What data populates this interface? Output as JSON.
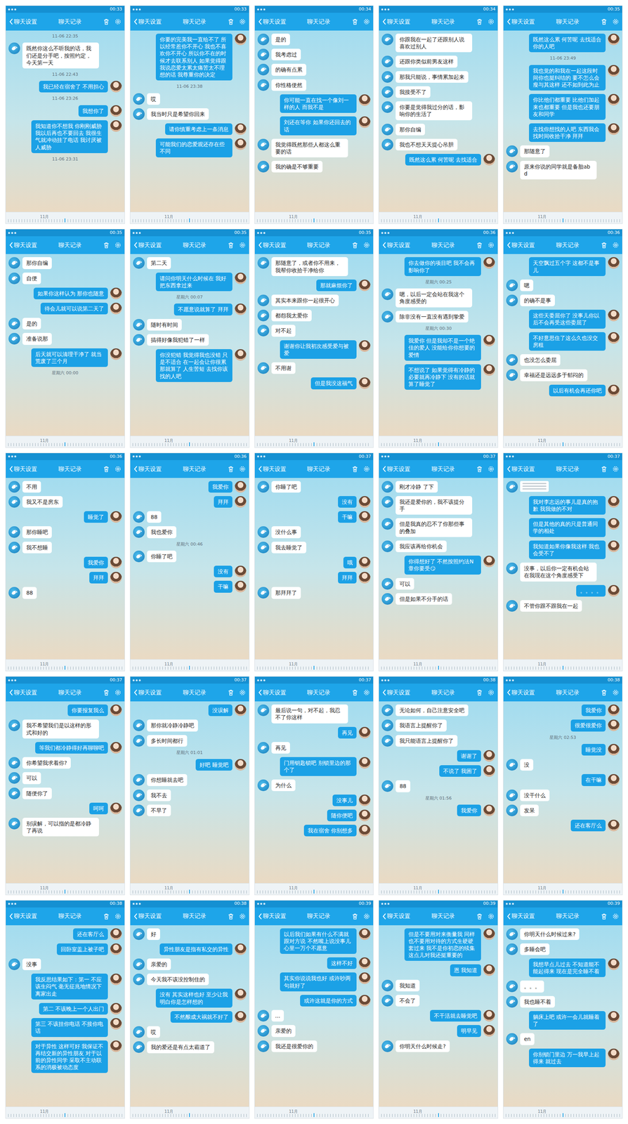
{
  "panels": [
    {
      "status_time": "00:33",
      "header": {
        "back": "聊天设置",
        "title": "聊天记录"
      },
      "timeline": "11月",
      "messages": [
        {
          "kind": "time",
          "text": "11-06 22:35"
        },
        {
          "kind": "in",
          "text": "既然你这么不听我的话，我们还是分手吧，按照约定，今天第一天"
        },
        {
          "kind": "time",
          "text": "11-06 22:43"
        },
        {
          "kind": "out",
          "text": "我已经在宿舍了  不用担心"
        },
        {
          "kind": "time",
          "text": "11-06 23:26"
        },
        {
          "kind": "out",
          "text": "我想你了"
        },
        {
          "kind": "out",
          "text": "我知道你不想我  你刚刚威胁我以后再也不要回去  我很生气就冲动挂了电话  我讨厌被人威胁"
        },
        {
          "kind": "time",
          "text": "11-06 23:31"
        }
      ]
    },
    {
      "status_time": "00:33",
      "header": {
        "back": "聊天设置",
        "title": "聊天记录"
      },
      "timeline": "11月",
      "messages": [
        {
          "kind": "out",
          "text": "你要的完美我一直给不了  所以经常惹你不开心  我也不喜欢你不开心  所以你不在的时候才去联系别人  如果觉得跟我说恋爱太累太痛苦太不理想的话  我尊重你的决定"
        },
        {
          "kind": "time",
          "text": "11-06 23:38"
        },
        {
          "kind": "in",
          "text": "哎"
        },
        {
          "kind": "in",
          "text": "我当时只是希望你回来"
        },
        {
          "kind": "out",
          "text": "请你慎重考虑上一条消息"
        },
        {
          "kind": "out",
          "text": "可能我们的恋爱观还存在些不同"
        }
      ]
    },
    {
      "status_time": "00:34",
      "header": {
        "back": "聊天设置",
        "title": "聊天记录"
      },
      "timeline": "11月",
      "messages": [
        {
          "kind": "in",
          "text": "是的"
        },
        {
          "kind": "in",
          "text": "我考虑过"
        },
        {
          "kind": "in",
          "text": "的确有点累"
        },
        {
          "kind": "in",
          "text": "你性格使然"
        },
        {
          "kind": "out",
          "text": "你可能一直在找一个像刘一样的人  而我不是"
        },
        {
          "kind": "out",
          "text": "刘还在等你  如果你还回去的话"
        },
        {
          "kind": "in",
          "text": "我觉得既然那些人都这么重要的话"
        },
        {
          "kind": "in",
          "text": "我的确是不够重要"
        }
      ]
    },
    {
      "status_time": "00:34",
      "header": {
        "back": "聊天设置",
        "title": "聊天记录"
      },
      "timeline": "11月",
      "messages": [
        {
          "kind": "in",
          "text": "你跟我在一起了还跟别人说喜欢过别人"
        },
        {
          "kind": "in",
          "text": "还跟你类似前男友这样"
        },
        {
          "kind": "in",
          "text": "那我只能说，事情累加起来"
        },
        {
          "kind": "in",
          "text": "我接受不了"
        },
        {
          "kind": "in",
          "text": "你要是觉得我过分的话，影响你的生活了"
        },
        {
          "kind": "in",
          "text": "那你自编"
        },
        {
          "kind": "in",
          "text": "我也不想天天提心吊胆"
        },
        {
          "kind": "out",
          "text": "既然这么累  何苦呢  去找适合"
        }
      ]
    },
    {
      "status_time": "00:35",
      "header": {
        "back": "聊天设置",
        "title": "聊天记录"
      },
      "timeline": "11月",
      "messages": [
        {
          "kind": "out",
          "text": "既然这么累  何苦呢  去找适合你的人吧"
        },
        {
          "kind": "time",
          "text": "11-06 23:49"
        },
        {
          "kind": "out",
          "text": "我也觉的和我在一起这段时间你也挺纠结的  要不怎么会瘦与其这样  还不如到此为止"
        },
        {
          "kind": "out",
          "text": "你比他们都重要  比他们加起来也都重要  但是我也还要朋友和同学"
        },
        {
          "kind": "out",
          "text": "去找你想找的人吧  东西我会找时间收拾干净  拜拜"
        },
        {
          "kind": "in",
          "text": "那随意了"
        },
        {
          "kind": "in",
          "text": "原来你说的同学就是备胎abd"
        }
      ]
    },
    {
      "status_time": "00:35",
      "header": {
        "back": "聊天设置",
        "title": "聊天记录"
      },
      "timeline": "11月",
      "messages": [
        {
          "kind": "in",
          "text": "那你自编"
        },
        {
          "kind": "in",
          "text": "自便"
        },
        {
          "kind": "out",
          "text": "如果你这样认为  那你也随意"
        },
        {
          "kind": "out",
          "text": "待会儿就可以说第二天了"
        },
        {
          "kind": "in",
          "text": "是的"
        },
        {
          "kind": "in",
          "text": "准备说那"
        },
        {
          "kind": "out",
          "text": "后天就可以清理干净了  就当荒废了三个月"
        },
        {
          "kind": "time",
          "text": "星期六 00:00"
        }
      ]
    },
    {
      "status_time": "00:35",
      "header": {
        "back": "聊天设置",
        "title": "聊天记录"
      },
      "timeline": "11月",
      "messages": [
        {
          "kind": "in",
          "text": "第二天"
        },
        {
          "kind": "out",
          "text": "请问你明天什么时候在  我好把东西拿过来"
        },
        {
          "kind": "time",
          "text": "星期六 00:07"
        },
        {
          "kind": "out",
          "text": "不愿意说就算了  拜拜"
        },
        {
          "kind": "in",
          "text": "随时有时间"
        },
        {
          "kind": "in",
          "text": "搞得好像我犯错了一样"
        },
        {
          "kind": "out",
          "text": "你没犯错  我觉得我也没错  只是不适合  在一起会让你很累那就算了  人生苦短  去找你该找的人吧"
        }
      ]
    },
    {
      "status_time": "00:35",
      "header": {
        "back": "聊天设置",
        "title": "聊天记录"
      },
      "timeline": "11月",
      "messages": [
        {
          "kind": "in",
          "text": "那随意了，或者你不用来，我帮你收拾干净给你"
        },
        {
          "kind": "out",
          "text": "那就麻烦你了"
        },
        {
          "kind": "in",
          "text": "其实本来跟你一起很开心"
        },
        {
          "kind": "in",
          "text": "都怨我太爱你"
        },
        {
          "kind": "in",
          "text": "对不起"
        },
        {
          "kind": "out",
          "text": "谢谢你让我初次感受爱与被爱"
        },
        {
          "kind": "in",
          "text": "不用谢"
        },
        {
          "kind": "out",
          "text": "但是我没这福气"
        }
      ]
    },
    {
      "status_time": "00:36",
      "header": {
        "back": "聊天设置",
        "title": "聊天记录"
      },
      "timeline": "11月",
      "messages": [
        {
          "kind": "out",
          "text": "你去做你的项目吧  我不会再影响你了"
        },
        {
          "kind": "time",
          "text": "星期六 00:25"
        },
        {
          "kind": "in",
          "text": "嗯，以后一定会站在我这个角度感受的"
        },
        {
          "kind": "in",
          "text": "除非没有一直没有遇到挚爱"
        },
        {
          "kind": "time",
          "text": "星期六 00:30"
        },
        {
          "kind": "out",
          "text": "我爱你  但是我却不是一个绝佳的爱人  没能给你你想要的爱情"
        },
        {
          "kind": "out",
          "text": "不想说了  如果觉得有冷静的必要就再冷静下  没有的话就算了睡觉了"
        }
      ]
    },
    {
      "status_time": "00:36",
      "header": {
        "back": "聊天设置",
        "title": "聊天记录"
      },
      "timeline": "11月",
      "messages": [
        {
          "kind": "out",
          "text": "天空飘过五个字  这都不是事儿"
        },
        {
          "kind": "in",
          "text": "嗯"
        },
        {
          "kind": "in",
          "text": "的确不是事"
        },
        {
          "kind": "out",
          "text": "这些天委屈你了  没事儿你以后不会再受这些委屈了"
        },
        {
          "kind": "out",
          "text": "不好意思住了这么久也没交房租"
        },
        {
          "kind": "in",
          "text": "也没怎么委屈"
        },
        {
          "kind": "in",
          "text": "幸福还是远远多于郁闷的"
        },
        {
          "kind": "out",
          "text": "以后有机会再还你吧"
        }
      ]
    },
    {
      "status_time": "00:36",
      "header": {
        "back": "聊天设置",
        "title": "聊天记录"
      },
      "timeline": "11月",
      "messages": [
        {
          "kind": "in",
          "text": "不用"
        },
        {
          "kind": "in",
          "text": "我又不是房东"
        },
        {
          "kind": "out",
          "text": "睡觉了"
        },
        {
          "kind": "in",
          "text": "那你睡吧"
        },
        {
          "kind": "in",
          "text": "我不想睡"
        },
        {
          "kind": "out",
          "text": "我爱你"
        },
        {
          "kind": "out",
          "text": "拜拜"
        },
        {
          "kind": "in",
          "text": "88"
        }
      ]
    },
    {
      "status_time": "00:36",
      "header": {
        "back": "聊天设置",
        "title": "聊天记录"
      },
      "timeline": "11月",
      "messages": [
        {
          "kind": "out",
          "text": "我爱你"
        },
        {
          "kind": "out",
          "text": "拜拜"
        },
        {
          "kind": "in",
          "text": "88"
        },
        {
          "kind": "in",
          "text": "我也爱你"
        },
        {
          "kind": "time",
          "text": "星期六 00:46"
        },
        {
          "kind": "in",
          "text": "你睡了吧"
        },
        {
          "kind": "out",
          "text": "没有"
        },
        {
          "kind": "out",
          "text": "干嘛"
        }
      ]
    },
    {
      "status_time": "00:37",
      "header": {
        "back": "聊天设置",
        "title": "聊天记录"
      },
      "timeline": "11月",
      "messages": [
        {
          "kind": "in",
          "text": "你睡了吧"
        },
        {
          "kind": "out",
          "text": "没有"
        },
        {
          "kind": "out",
          "text": "干嘛"
        },
        {
          "kind": "in",
          "text": "没什么事"
        },
        {
          "kind": "in",
          "text": "我去睡觉了"
        },
        {
          "kind": "out",
          "text": "哦"
        },
        {
          "kind": "out",
          "text": "拜拜"
        },
        {
          "kind": "in",
          "text": "那拜拜了"
        }
      ]
    },
    {
      "status_time": "00:37",
      "header": {
        "back": "聊天设置",
        "title": "聊天记录"
      },
      "timeline": "11月",
      "messages": [
        {
          "kind": "in",
          "text": "刚才冷静  了下"
        },
        {
          "kind": "in",
          "text": "我还是爱你的，我不该提分手"
        },
        {
          "kind": "in",
          "text": "但是我真的忍不了你那些事的叠加"
        },
        {
          "kind": "in",
          "text": "我应该再给你机会"
        },
        {
          "kind": "out",
          "text": "你得想好了  不然按照约法N章你要受😏"
        },
        {
          "kind": "in",
          "text": "可以"
        },
        {
          "kind": "in",
          "text": "但是如果不分手的话"
        }
      ]
    },
    {
      "status_time": "00:37",
      "header": {
        "back": "聊天设置",
        "title": "聊天记录"
      },
      "timeline": "11月",
      "messages": [
        {
          "kind": "image"
        },
        {
          "kind": "out",
          "text": "我对李志远的事儿是真的抱歉  我我做的不对"
        },
        {
          "kind": "out",
          "text": "但是其他的真的只是普通同学的相处"
        },
        {
          "kind": "out",
          "text": "我知道如果你像我这样  我也会受不了"
        },
        {
          "kind": "in",
          "text": "没事，以后你一定有机会站在我现在这个角度感受下"
        },
        {
          "kind": "out",
          "text": "。。。。"
        },
        {
          "kind": "in",
          "text": "不管你跟不跟我在一起"
        }
      ]
    },
    {
      "status_time": "00:37",
      "header": {
        "back": "聊天设置",
        "title": "聊天记录"
      },
      "timeline": "11月",
      "messages": [
        {
          "kind": "out",
          "text": "你要报复我么"
        },
        {
          "kind": "in",
          "text": "我不希望我们是以这样的形式和好的"
        },
        {
          "kind": "out",
          "text": "等我们都冷静得好再聊聊吧"
        },
        {
          "kind": "in",
          "text": "你希望我求着你?"
        },
        {
          "kind": "in",
          "text": "可以"
        },
        {
          "kind": "in",
          "text": "随便你了"
        },
        {
          "kind": "out",
          "text": "呵呵"
        },
        {
          "kind": "in",
          "text": "别误解，可以指的是都冷静了再说"
        }
      ]
    },
    {
      "status_time": "00:37",
      "header": {
        "back": "聊天设置",
        "title": "聊天记录"
      },
      "timeline": "11月",
      "messages": [
        {
          "kind": "out",
          "text": "没误解"
        },
        {
          "kind": "in",
          "text": "那你就冷静冷静吧"
        },
        {
          "kind": "in",
          "text": "多长时间都行"
        },
        {
          "kind": "time",
          "text": "星期六 01:01"
        },
        {
          "kind": "out",
          "text": "好吧  睡觉吧"
        },
        {
          "kind": "in",
          "text": "你想睡就去吧"
        },
        {
          "kind": "in",
          "text": "我不去"
        },
        {
          "kind": "in",
          "text": "不早了"
        }
      ]
    },
    {
      "status_time": "00:37",
      "header": {
        "back": "聊天设置",
        "title": "聊天记录"
      },
      "timeline": "11月",
      "messages": [
        {
          "kind": "in",
          "text": "最后说一句，对不起，我忍不了你这样"
        },
        {
          "kind": "out",
          "text": "再见"
        },
        {
          "kind": "in",
          "text": "再见"
        },
        {
          "kind": "out",
          "text": "门用钥匙锁吧  别锁里边的那个了"
        },
        {
          "kind": "in",
          "text": "为什么"
        },
        {
          "kind": "out",
          "text": "没事儿"
        },
        {
          "kind": "out",
          "text": "随你便吧"
        },
        {
          "kind": "out",
          "text": "我在宿舍  你别想多"
        }
      ]
    },
    {
      "status_time": "00:38",
      "header": {
        "back": "聊天设置",
        "title": "聊天记录"
      },
      "timeline": "11月",
      "messages": [
        {
          "kind": "in",
          "text": "无论如何，自己注意安全吧"
        },
        {
          "kind": "in",
          "text": "我语言上提醒你了"
        },
        {
          "kind": "in",
          "text": "我只能语言上提醒你了"
        },
        {
          "kind": "out",
          "text": "谢谢了"
        },
        {
          "kind": "out",
          "text": "不说了  我困了"
        },
        {
          "kind": "in",
          "text": "88"
        },
        {
          "kind": "time",
          "text": "星期六 01:56"
        },
        {
          "kind": "out",
          "text": "我爱你"
        }
      ]
    },
    {
      "status_time": "00:38",
      "header": {
        "back": "聊天设置",
        "title": "聊天记录"
      },
      "timeline": "11月",
      "messages": [
        {
          "kind": "out",
          "text": "我爱你"
        },
        {
          "kind": "out",
          "text": "很爱很爱你"
        },
        {
          "kind": "time",
          "text": "星期六 02:53"
        },
        {
          "kind": "out",
          "text": "睡觉没"
        },
        {
          "kind": "in",
          "text": "没"
        },
        {
          "kind": "out",
          "text": "在干嘛"
        },
        {
          "kind": "in",
          "text": "没干什么"
        },
        {
          "kind": "in",
          "text": "发呆"
        },
        {
          "kind": "out",
          "text": "还在客厅么"
        }
      ]
    },
    {
      "status_time": "00:38",
      "header": {
        "back": "聊天设置",
        "title": "聊天记录"
      },
      "timeline": "11月",
      "messages": [
        {
          "kind": "out",
          "text": "还在客厅么"
        },
        {
          "kind": "out",
          "text": "回卧室盖上被子吧"
        },
        {
          "kind": "in",
          "text": "没事"
        },
        {
          "kind": "out",
          "text": "我反思结果如下：第一  不应该生闷气  毫无征兆地情况下  离家出走"
        },
        {
          "kind": "out",
          "text": "第二  不该晚上一个人出门"
        },
        {
          "kind": "out",
          "text": "第三  不该挂你电话  不接你电话"
        },
        {
          "kind": "out",
          "text": "对于异性  这样可好  我保证不再结交新的异性朋友  对于以前的异性同学  采取不主动联系的消极被动态度"
        }
      ]
    },
    {
      "status_time": "00:38",
      "header": {
        "back": "聊天设置",
        "title": "聊天记录"
      },
      "timeline": "11月",
      "messages": [
        {
          "kind": "in",
          "text": "好"
        },
        {
          "kind": "out",
          "text": "异性朋友是指有私交的异性"
        },
        {
          "kind": "in",
          "text": "亲爱的"
        },
        {
          "kind": "in",
          "text": "今天我不该没控制住的"
        },
        {
          "kind": "out",
          "text": "没有  其实这样也好  至少让我明白你是怎样想的"
        },
        {
          "kind": "out",
          "text": "不然酿成大祸就不好了"
        },
        {
          "kind": "in",
          "text": "哎"
        },
        {
          "kind": "in",
          "text": "我的爱还是有点太霸道了"
        }
      ]
    },
    {
      "status_time": "00:39",
      "header": {
        "back": "聊天设置",
        "title": "聊天记录"
      },
      "timeline": "11月",
      "messages": [
        {
          "kind": "out",
          "text": "以后我们如果有什么不满就跟对方说  不然嘴上说没事儿  心里一万个不愿意"
        },
        {
          "kind": "out",
          "text": "这样不好"
        },
        {
          "kind": "out",
          "text": "其实你说说我也好  或许吵两句就好了"
        },
        {
          "kind": "out",
          "text": "或许这就是你的方式"
        },
        {
          "kind": "in",
          "text": "..."
        },
        {
          "kind": "in",
          "text": "亲爱的"
        },
        {
          "kind": "in",
          "text": "我还是很爱你的"
        }
      ]
    },
    {
      "status_time": "00:39",
      "header": {
        "back": "聊天设置",
        "title": "聊天记录"
      },
      "timeline": "11月",
      "messages": [
        {
          "kind": "out",
          "text": "但是不要用对来衡量我  同样也不要用对待的方式生硬硬套过来  我不是你初恋的续集  这点儿对我还挺重要的"
        },
        {
          "kind": "out",
          "text": "恩  我知道"
        },
        {
          "kind": "in",
          "text": "我知道"
        },
        {
          "kind": "in",
          "text": "不会了"
        },
        {
          "kind": "out",
          "text": "不干活就去睡觉吧"
        },
        {
          "kind": "out",
          "text": "明早见"
        },
        {
          "kind": "in",
          "text": "你明天什么时候走?"
        }
      ]
    },
    {
      "status_time": "00:39",
      "header": {
        "back": "聊天设置",
        "title": "聊天记录"
      },
      "timeline": "11月",
      "messages": [
        {
          "kind": "in",
          "text": "你明天什么时候过来?"
        },
        {
          "kind": "in",
          "text": "多睡会吧"
        },
        {
          "kind": "out",
          "text": "我想早点儿过去  不知道能不能起得来  现在是完全睡不着"
        },
        {
          "kind": "in",
          "text": "。。。"
        },
        {
          "kind": "in",
          "text": "我也睡不着"
        },
        {
          "kind": "out",
          "text": "躺床上吧  或许一会儿就睡着了"
        },
        {
          "kind": "in",
          "text": "en"
        },
        {
          "kind": "out",
          "text": "你别锁门里边  万一我早上起得来  就过去"
        }
      ]
    }
  ]
}
